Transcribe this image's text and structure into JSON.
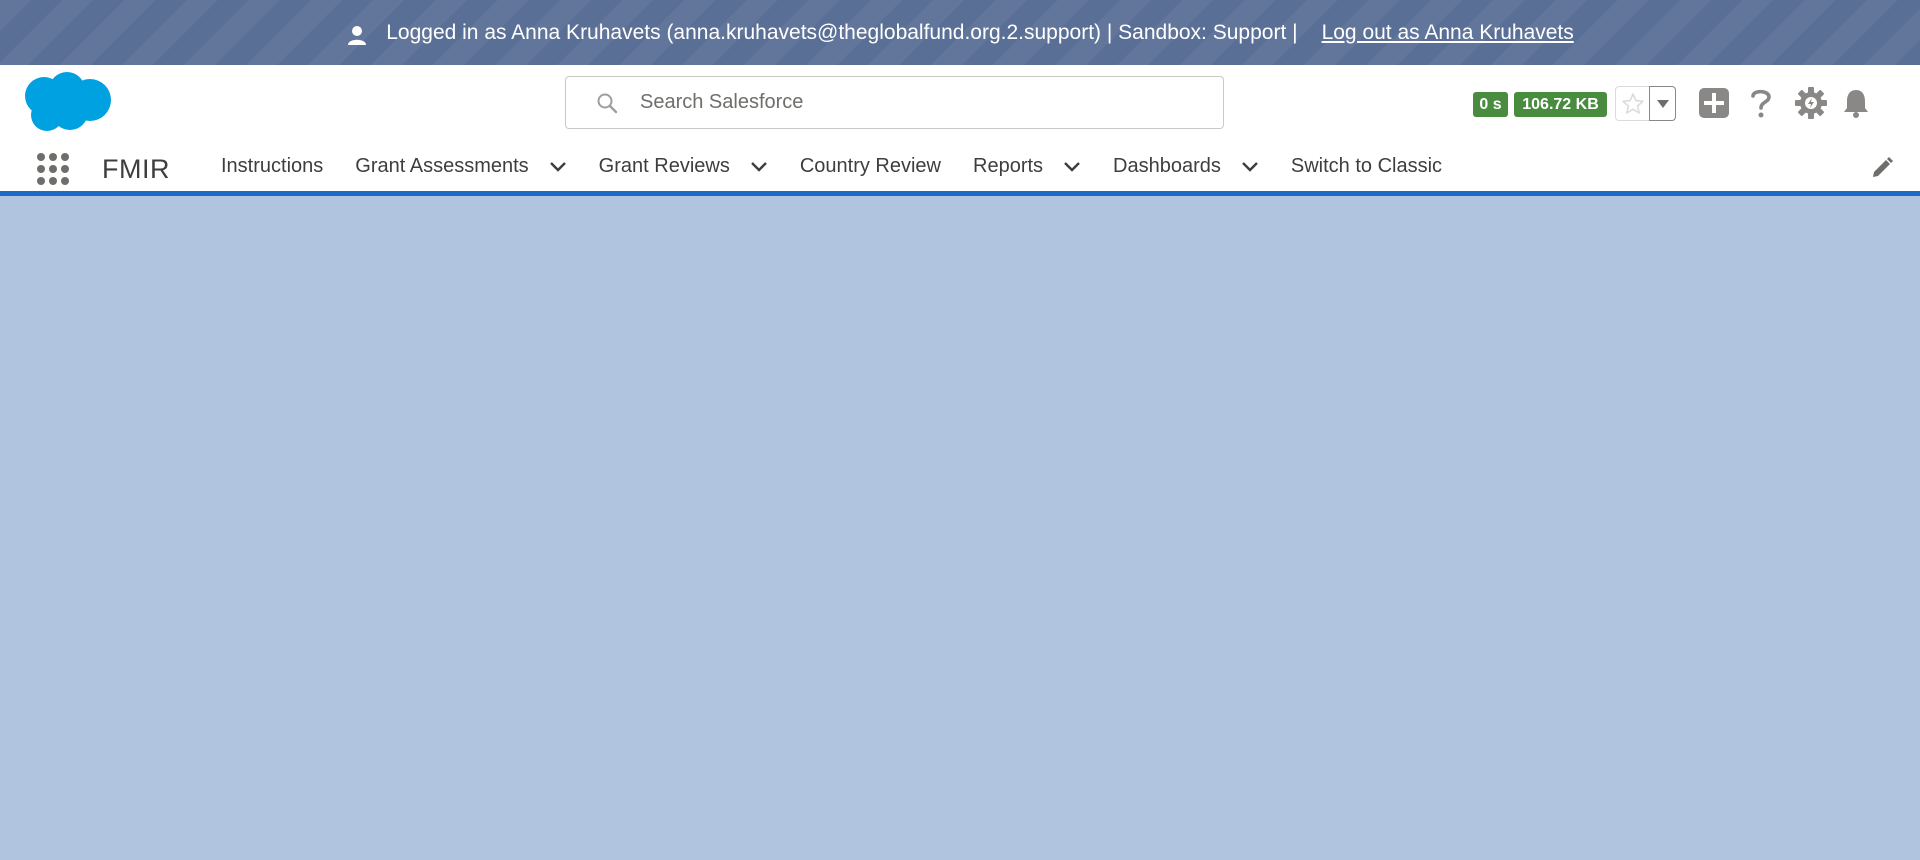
{
  "banner": {
    "user_icon": "user-icon",
    "text": "Logged in as Anna Kruhavets (anna.kruhavets@theglobalfund.org.2.support) | Sandbox: Support |",
    "logout_label": "Log out as Anna Kruhavets"
  },
  "header": {
    "logo_icon": "salesforce-cloud-logo",
    "search": {
      "placeholder": "Search Salesforce",
      "value": ""
    },
    "badges": {
      "time": "0 s",
      "size": "106.72 KB"
    },
    "icons": [
      "star-icon",
      "chevron-down-icon",
      "plus-icon",
      "help-icon",
      "setup-gear-icon",
      "bell-icon"
    ]
  },
  "nav": {
    "app_name": "FMIR",
    "items": [
      {
        "label": "Instructions",
        "has_menu": false
      },
      {
        "label": "Grant Assessments",
        "has_menu": true
      },
      {
        "label": "Grant Reviews",
        "has_menu": true
      },
      {
        "label": "Country Review",
        "has_menu": false
      },
      {
        "label": "Reports",
        "has_menu": true
      },
      {
        "label": "Dashboards",
        "has_menu": true
      },
      {
        "label": "Switch to Classic",
        "has_menu": false
      }
    ]
  },
  "colors": {
    "banner_bg": "#5a6f96",
    "nav_accent": "#1b6ac9",
    "content_bg": "#b0c4df",
    "brand_cloud": "#00a1e0",
    "badge_green": "#4a8c3f"
  }
}
